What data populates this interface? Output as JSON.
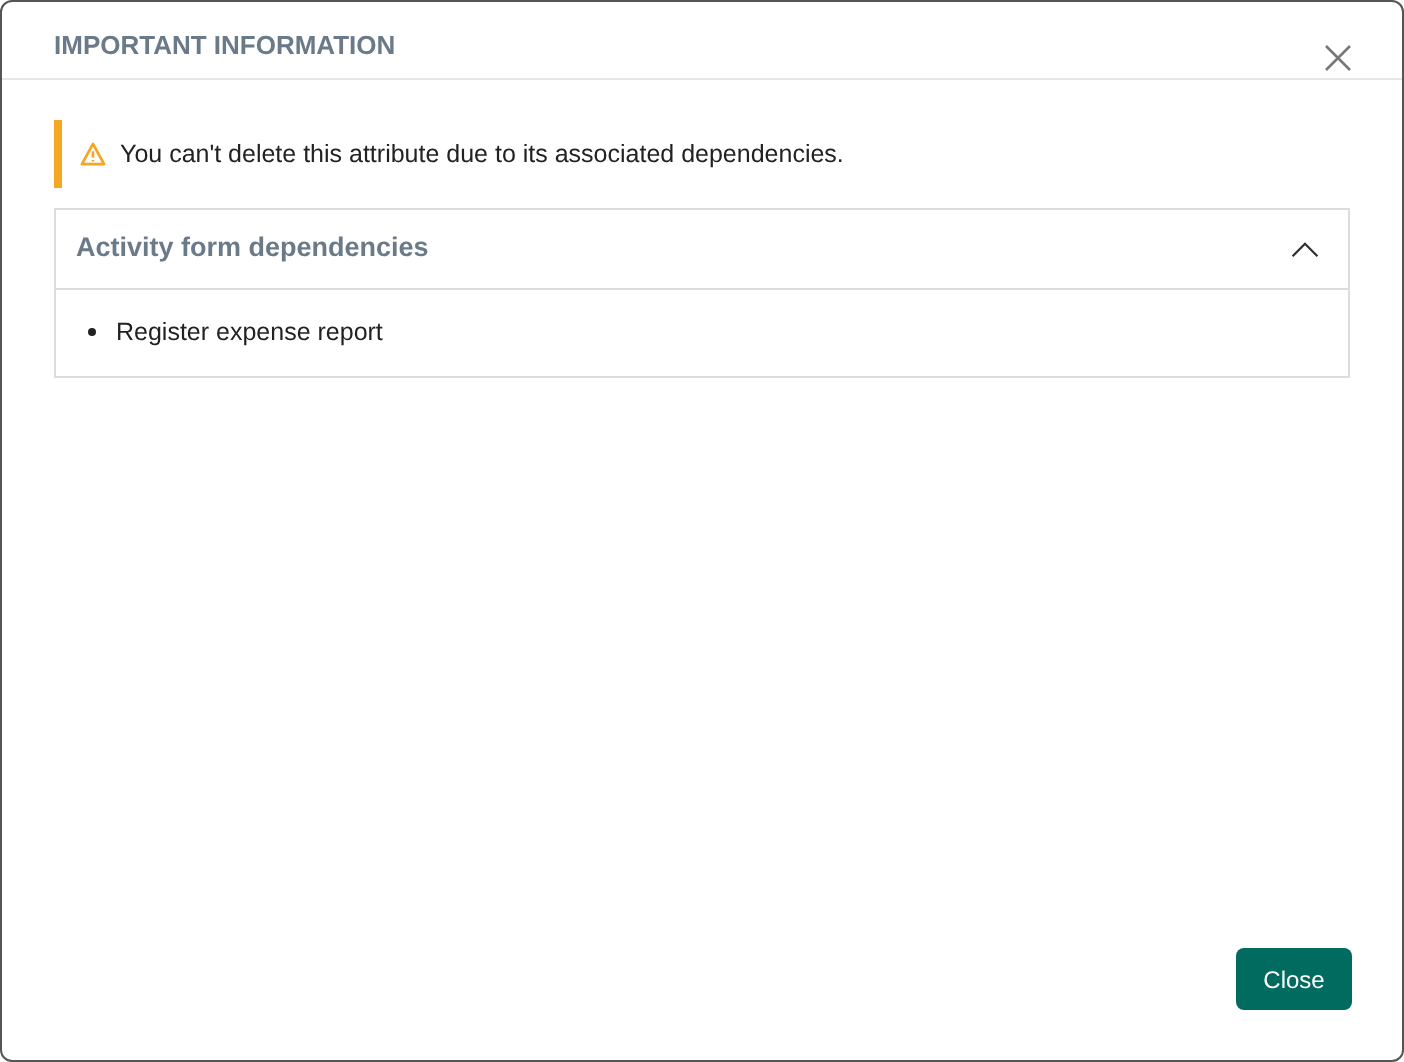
{
  "dialog": {
    "title": "IMPORTANT INFORMATION"
  },
  "alert": {
    "message": "You can't delete this attribute due to its associated dependencies."
  },
  "panel": {
    "title": "Activity form dependencies",
    "expanded": true,
    "items": [
      "Register expense report"
    ]
  },
  "buttons": [
    "Close"
  ]
}
